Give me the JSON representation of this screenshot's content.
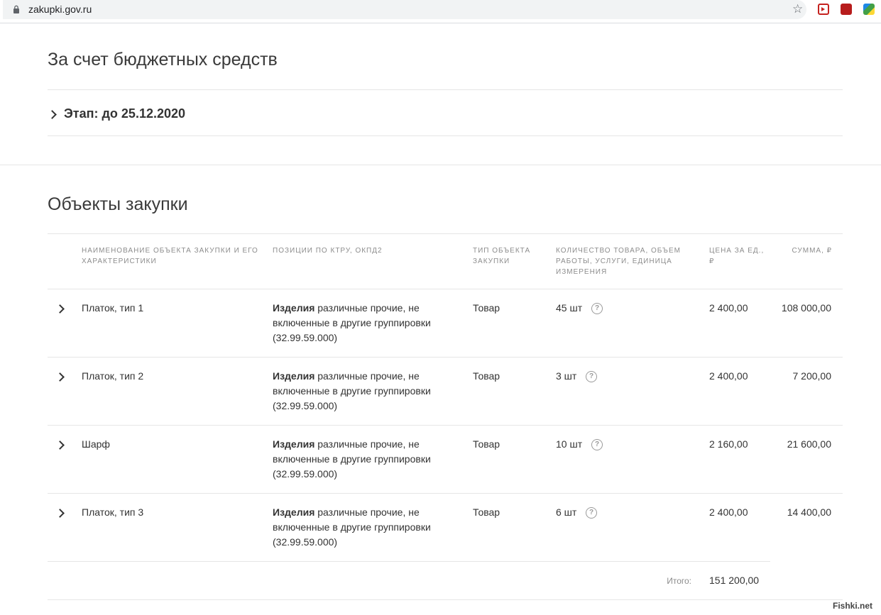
{
  "browser": {
    "url": "zakupki.gov.ru"
  },
  "funding": {
    "title": "За счет бюджетных средств",
    "stage": "Этап: до 25.12.2020"
  },
  "objects": {
    "title": "Объекты закупки",
    "headers": {
      "name": "НАИМЕНОВАНИЕ ОБЪЕКТА ЗАКУПКИ И ЕГО ХАРАКТЕРИСТИКИ",
      "positions": "ПОЗИЦИИ ПО КТРУ, ОКПД2",
      "type": "ТИП ОБЪЕКТА ЗАКУПКИ",
      "quantity": "КОЛИЧЕСТВО ТОВАРА, ОБЪЕМ РАБОТЫ, УСЛУГИ, ЕДИНИЦА ИЗМЕРЕНИЯ",
      "price": "ЦЕНА ЗА ЕД., ₽",
      "sum": "СУММА, ₽"
    },
    "rows": [
      {
        "name": "Платок, тип 1",
        "position_bold": "Изделия",
        "position_rest": " различные прочие, не включенные в другие группировки (32.99.59.000)",
        "type": "Товар",
        "quantity": "45 шт",
        "price": "2 400,00",
        "sum": "108 000,00"
      },
      {
        "name": "Платок, тип 2",
        "position_bold": "Изделия",
        "position_rest": " различные прочие, не включенные в другие группировки (32.99.59.000)",
        "type": "Товар",
        "quantity": "3 шт",
        "price": "2 400,00",
        "sum": "7 200,00"
      },
      {
        "name": "Шарф",
        "position_bold": "Изделия",
        "position_rest": " различные прочие, не включенные в другие группировки (32.99.59.000)",
        "type": "Товар",
        "quantity": "10 шт",
        "price": "2 160,00",
        "sum": "21 600,00"
      },
      {
        "name": "Платок, тип 3",
        "position_bold": "Изделия",
        "position_rest": " различные прочие, не включенные в другие группировки (32.99.59.000)",
        "type": "Товар",
        "quantity": "6 шт",
        "price": "2 400,00",
        "sum": "14 400,00"
      }
    ],
    "total_label": "Итого:",
    "total_value": "151 200,00"
  },
  "help_glyph": "?",
  "watermark": "Fishki.net"
}
